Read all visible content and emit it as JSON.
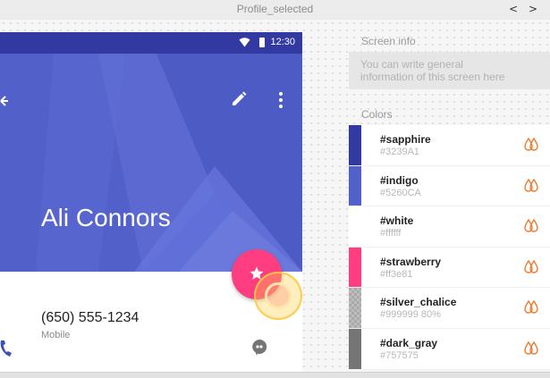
{
  "window": {
    "title": "Profile_selected",
    "prev_label": "<",
    "next_label": ">"
  },
  "statusbar": {
    "time": "12:30"
  },
  "contact": {
    "name": "Ali Connors",
    "phone": "(650) 555-1234",
    "phone_type": "Mobile"
  },
  "icons": {
    "back": "arrow-back-icon",
    "edit": "pencil-icon",
    "more": "more-vert-icon",
    "fab": "star-icon",
    "call": "phone-icon",
    "message": "chat-bubble-icon",
    "wifi": "wifi-icon",
    "battery": "battery-icon",
    "copy": "drop-icon"
  },
  "panel": {
    "screen_info_title": "Screen info",
    "screen_info_line1": "You can write general",
    "screen_info_line2": "information of this screen here",
    "colors_title": "Colors",
    "colors": [
      {
        "name": "#sapphire",
        "value": "#3239A1",
        "hex": "#3239A1"
      },
      {
        "name": "#indigo",
        "value": "#5260CA",
        "hex": "#5260CA"
      },
      {
        "name": "#white",
        "value": "#ffffff",
        "hex": "#ffffff"
      },
      {
        "name": "#strawberry",
        "value": "#ff3e81",
        "hex": "#ff3e81"
      },
      {
        "name": "#silver_chalice",
        "value": "#999999  80%",
        "hex": "#999999"
      },
      {
        "name": "#dark_gray",
        "value": "#757575",
        "hex": "#757575"
      }
    ]
  },
  "theme": {
    "accent_drop": "#f0782d",
    "header": "#5260CA",
    "statusbar": "#3239A1",
    "fab": "#ff3e81"
  }
}
